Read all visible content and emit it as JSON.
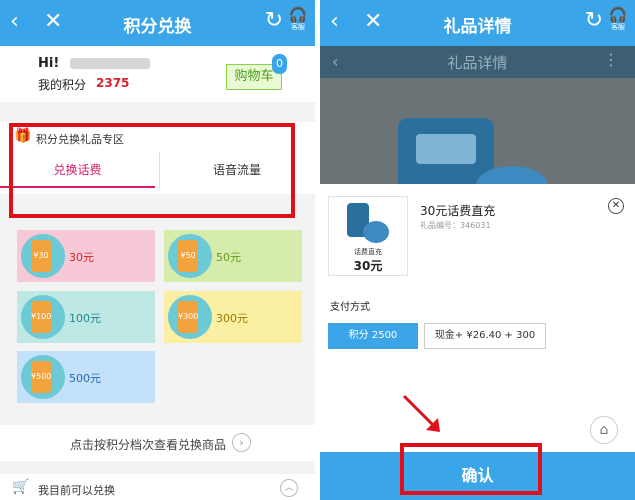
{
  "left": {
    "topbar": {
      "back": "‹",
      "close": "✕",
      "title": "积分兑换",
      "refresh": "↻",
      "service_icon": "🎧",
      "service_label": "客服"
    },
    "user": {
      "greeting": "Hi!",
      "points_label": "我的积分",
      "points": "2375"
    },
    "cart": {
      "label": "购物车",
      "badge": "0"
    },
    "zone": {
      "title": "积分兑换礼品专区"
    },
    "tabs": [
      {
        "label": "兑换话费"
      },
      {
        "label": "语音流量"
      }
    ],
    "cards": [
      {
        "face": "¥30",
        "amount": "30元"
      },
      {
        "face": "¥50",
        "amount": "50元"
      },
      {
        "face": "¥100",
        "amount": "100元"
      },
      {
        "face": "¥300",
        "amount": "300元"
      },
      {
        "face": "¥500",
        "amount": "500元"
      }
    ],
    "by_archive": {
      "text": "点击按积分档次查看兑换商品",
      "arrow": "›"
    },
    "can_exchange": {
      "text": "我目前可以兑换",
      "chevron": "︿"
    }
  },
  "right": {
    "topbar": {
      "back": "‹",
      "close": "✕",
      "title": "礼品详情",
      "refresh": "↻",
      "service_icon": "🎧",
      "service_label": "客服"
    },
    "ghost_header": {
      "back": "‹",
      "title": "礼品详情",
      "more": "⋮"
    },
    "product": {
      "thumb_label": "话费直充",
      "thumb_value": "30元",
      "name": "30元话费直充",
      "number": "礼品编号：346031"
    },
    "close": "✕",
    "pay": {
      "label": "支付方式",
      "option1": "积分 2500",
      "option2": "现金+ ¥26.40 + 300"
    },
    "home_icon": "⌂",
    "confirm": "确认"
  }
}
